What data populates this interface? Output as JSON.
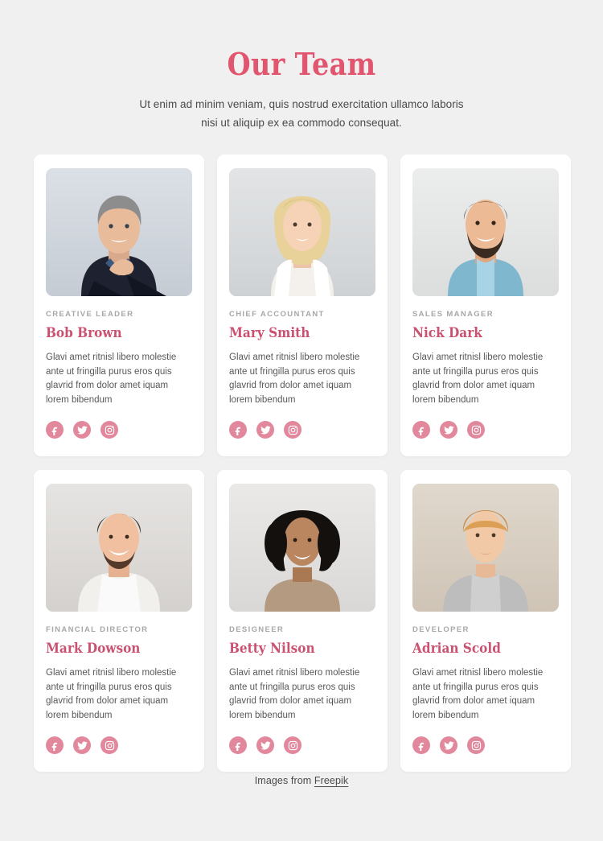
{
  "header": {
    "title": "Our Team",
    "subtitle_line1": "Ut enim ad minim veniam, quis nostrud exercitation ullamco laboris",
    "subtitle_line2": "nisi ut aliquip ex ea commodo consequat."
  },
  "colors": {
    "page_background": "#f0f0f0",
    "card_background": "#ffffff",
    "title_accent": "#e2556f",
    "name_accent": "#ca5270",
    "social_icon": "#e2889c",
    "role_label": "#a7a7a7",
    "body_text": "#58585a"
  },
  "social_labels": {
    "facebook": "Facebook",
    "twitter": "Twitter",
    "instagram": "Instagram"
  },
  "members": [
    {
      "role": "CREATIVE LEADER",
      "name": "Bob Brown",
      "bio": "Glavi amet ritnisl libero molestie ante ut fringilla purus eros quis glavrid from dolor amet iquam lorem bibendum",
      "photo_alt": "Smiling middle-aged man in dark suit with hand on chin",
      "photo_bg": "#cfd5dc"
    },
    {
      "role": "CHIEF ACCOUNTANT",
      "name": "Mary Smith",
      "bio": "Glavi amet ritnisl libero molestie ante ut fringilla purus eros quis glavrid from dolor amet iquam lorem bibendum",
      "photo_alt": "Smiling blonde woman in white cardigan",
      "photo_bg": "#d6d8da"
    },
    {
      "role": "SALES MANAGER",
      "name": "Nick Dark",
      "bio": "Glavi amet ritnisl libero molestie ante ut fringilla purus eros quis glavrid from dolor amet iquam lorem bibendum",
      "photo_alt": "Bearded man in light blue shirt smiling",
      "photo_bg": "#e3e4e5"
    },
    {
      "role": "FINANCIAL DIRECTOR",
      "name": "Mark Dowson",
      "bio": "Glavi amet ritnisl libero molestie ante ut fringilla purus eros quis glavrid from dolor amet iquam lorem bibendum",
      "photo_alt": "Young man with beard in white t-shirt laughing",
      "photo_bg": "#dedcda"
    },
    {
      "role": "DESIGNEER",
      "name": "Betty Nilson",
      "bio": "Glavi amet ritnisl libero molestie ante ut fringilla purus eros quis glavrid from dolor amet iquam lorem bibendum",
      "photo_alt": "Smiling woman with curly dark hair in beige top",
      "photo_bg": "#e2e1e0"
    },
    {
      "role": "DEVELOPER",
      "name": "Adrian Scold",
      "bio": "Glavi amet ritnisl libero molestie ante ut fringilla purus eros quis glavrid from dolor amet iquam lorem bibendum",
      "photo_alt": "Young man with light brown hair in grey hoodie",
      "photo_bg": "#d9d2c9"
    }
  ],
  "footer": {
    "credit_prefix": "Images from ",
    "credit_link": "Freepik"
  }
}
